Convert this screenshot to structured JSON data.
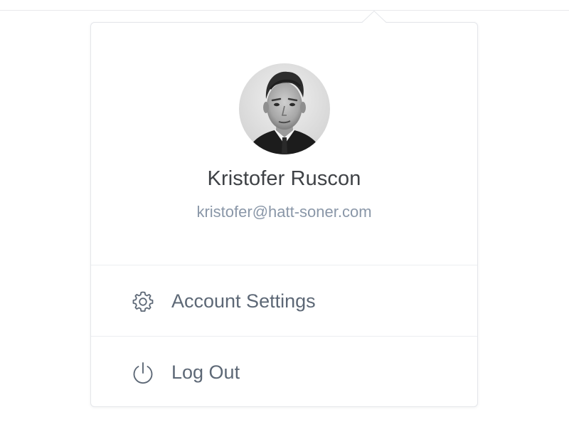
{
  "profile": {
    "name": "Kristofer Ruscon",
    "email": "kristofer@hatt-soner.com",
    "avatar": "user-portrait-photo"
  },
  "menu": {
    "items": [
      {
        "label": "Account Settings",
        "icon": "gear-icon"
      },
      {
        "label": "Log Out",
        "icon": "power-icon"
      }
    ]
  },
  "colors": {
    "name_text": "#3f4246",
    "email_text": "#8a97a8",
    "menu_text": "#5d6876",
    "divider": "#eceef1"
  }
}
